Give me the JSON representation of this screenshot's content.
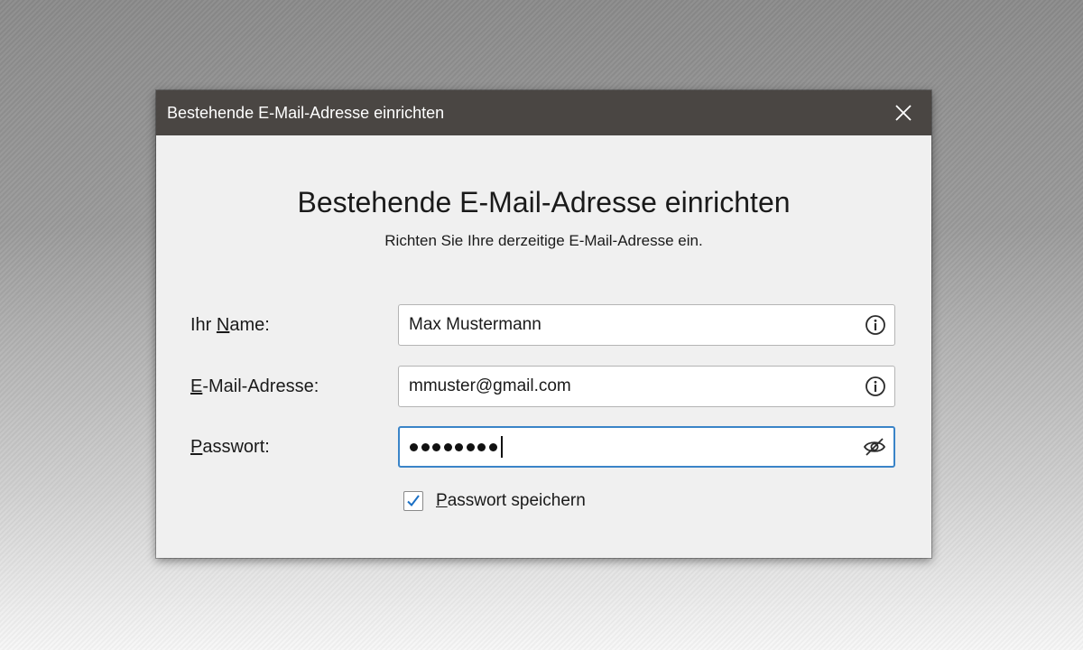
{
  "dialog": {
    "title": "Bestehende E-Mail-Adresse einrichten",
    "heading": "Bestehende E-Mail-Adresse einrichten",
    "subheading": "Richten Sie Ihre derzeitige E-Mail-Adresse ein."
  },
  "form": {
    "name": {
      "label_pre": "Ihr ",
      "label_key": "N",
      "label_post": "ame:",
      "value": "Max Mustermann"
    },
    "email": {
      "label_pre": "",
      "label_key": "E",
      "label_post": "-Mail-Adresse:",
      "value": "mmuster@gmail.com"
    },
    "password": {
      "label_pre": "",
      "label_key": "P",
      "label_post": "asswort:",
      "masked_length": 8
    },
    "remember": {
      "label_pre": "",
      "label_key": "P",
      "label_post": "asswort speichern",
      "checked": true
    }
  },
  "colors": {
    "titlebar": "#4a4643",
    "focus_border": "#3a84c8",
    "check": "#1a6fc4"
  },
  "icons": {
    "close": "close-icon",
    "info": "info-icon",
    "toggle_password": "eye-slash-icon",
    "check": "checkmark-icon"
  }
}
